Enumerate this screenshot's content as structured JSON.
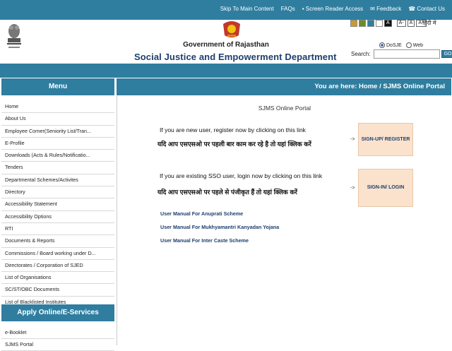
{
  "top_links": [
    "Skip To Main Content",
    "FAQs",
    "Screen Reader Access",
    "Feedback",
    "Contact Us"
  ],
  "header": {
    "government": "Government of Rajasthan",
    "department": "Social Justice and Empowerment Department",
    "font_buttons": [
      "A-",
      "A",
      "A+"
    ],
    "contrast_label": "A",
    "hindi_link": "हिंदी मे",
    "radio_options": [
      "DoSJE",
      "Web"
    ],
    "search_label": "Search:",
    "go_label": "GO"
  },
  "menu": {
    "title": "Menu",
    "items": [
      "Home",
      "About Us",
      "Employee Corner(Seniority List/Tran...",
      "E-Profile",
      "Downloads (Acts & Rules/Notificatio...",
      "Tenders",
      "Departmental Schemes/Activites",
      "Directory",
      "Accessibility Statement",
      "Accessibility Options",
      "RTI",
      "Documents & Reports",
      "Commissions / Board working under D...",
      "Directorates / Corporation of SJED",
      "List of Organisations",
      "SC/ST/OBC Documents",
      "List of Blacklisted Institutes"
    ]
  },
  "apply": {
    "title": "Apply Online/E-Services",
    "items": [
      "e-Booklet",
      "SJMS Portal"
    ]
  },
  "breadcrumb": {
    "prefix": "You are here:",
    "home": "Home",
    "sep": "/",
    "current": "SJMS Online Portal"
  },
  "content": {
    "title": "SJMS Online Portal",
    "new_user_en": "If you are new user, register now by clicking on this link",
    "new_user_hi": "यदि आप एसएसओ पर पहली बार काम कर रहे है तो यहां क्लिक करें",
    "signup_label": "SIGN-UP/ REGISTER",
    "existing_user_en": "If you are existing SSO user, login now by clicking on this link",
    "existing_user_hi": "यदि आप एसएसओ पर पहले से पंजीकृत हैं तो यहां क्लिक करें",
    "signin_label": "SIGN-IN/ LOGIN",
    "arrow": "->",
    "manuals": [
      "User Manual For Anuprati Scheme",
      "User Manual For Mukhyamantri Kanyadan Yojana",
      "User Manual For Inter Caste Scheme"
    ]
  },
  "colors": {
    "teal": "#2f7ea0",
    "navy": "#1d3f6e",
    "peach": "#fbe2cc"
  }
}
